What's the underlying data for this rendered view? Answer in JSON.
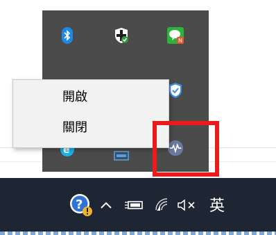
{
  "context_menu": {
    "items": [
      {
        "label": "開啟"
      },
      {
        "label": "關閉"
      }
    ]
  },
  "tray_icons": [
    {
      "name": "bluetooth-icon",
      "color": "#1e88e5"
    },
    {
      "name": "shield-check-icon",
      "color": "#ffffff"
    },
    {
      "name": "line-chat-icon",
      "color": "#2bb33a"
    },
    {
      "name": "defender-shield-icon",
      "color": "#3b8de6"
    },
    {
      "name": "edge-icon",
      "color": "#1bb3e8"
    },
    {
      "name": "network-adapter-icon",
      "color": "#4aa3f0"
    },
    {
      "name": "heartbeat-monitor-icon",
      "color": "#6a7a9e"
    }
  ],
  "taskbar": {
    "help_icon": "help-icon",
    "chevron_icon": "chevron-up-icon",
    "battery_icon": "battery-icon",
    "wifi_icon": "wifi-icon",
    "volume_icon": "volume-muted-icon",
    "ime_label": "英"
  },
  "colors": {
    "highlight": "#ec1b1b",
    "taskbar_bg": "#1f2633",
    "flyout_bg": "#4b4b4b"
  }
}
